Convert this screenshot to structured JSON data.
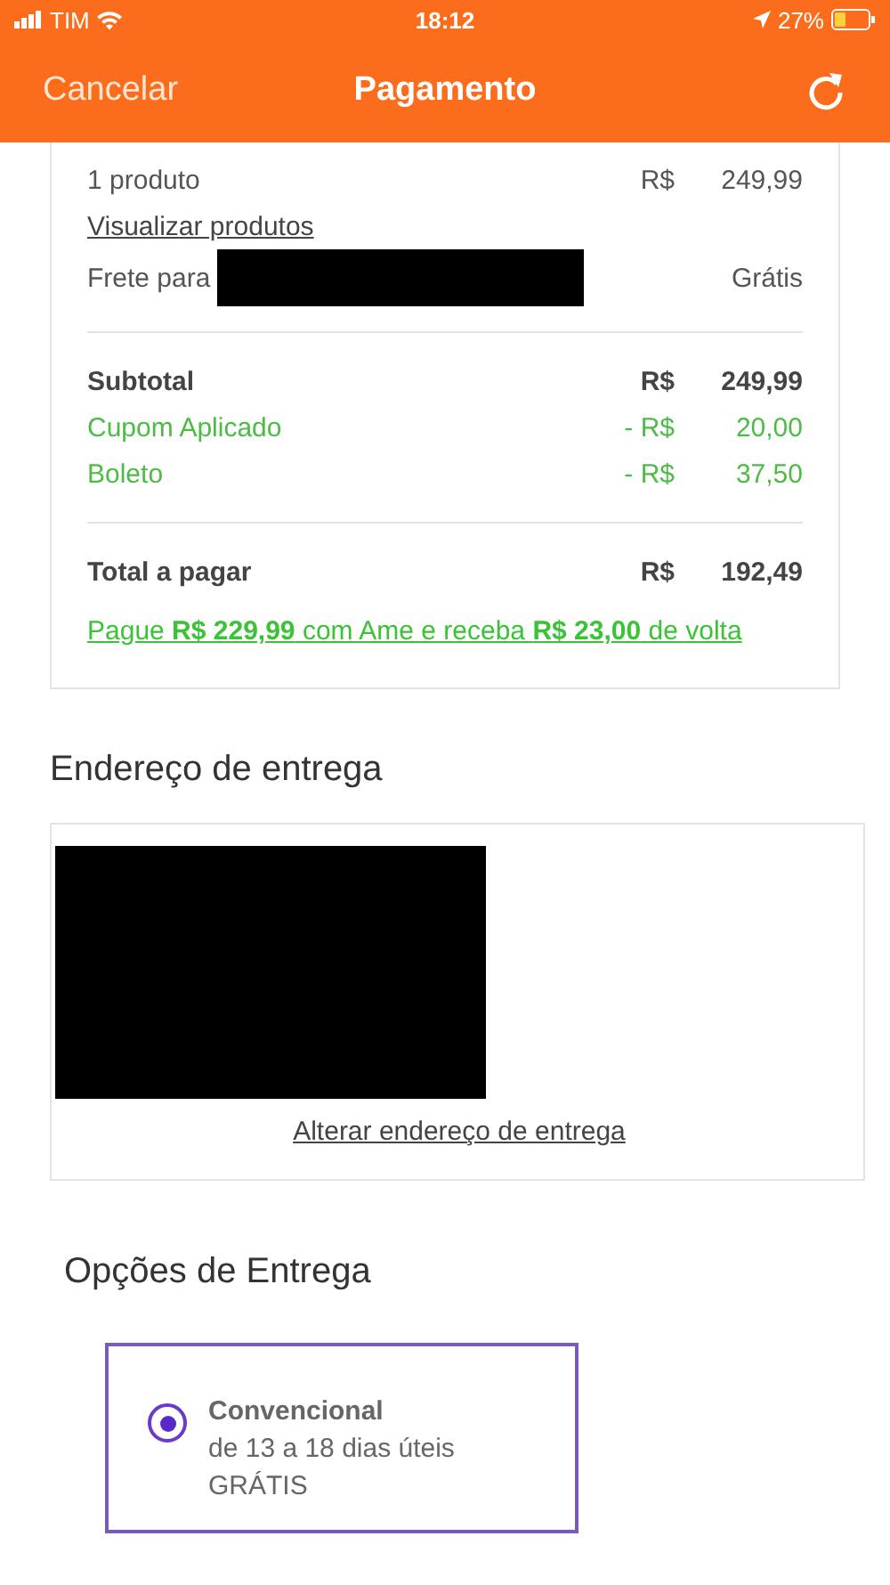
{
  "status_bar": {
    "carrier": "TIM",
    "time": "18:12",
    "battery": "27%"
  },
  "nav": {
    "cancel": "Cancelar",
    "title": "Pagamento"
  },
  "summary": {
    "product_count": "1 produto",
    "product_price": {
      "currency": "R$",
      "amount": "249,99"
    },
    "view_link": "Visualizar produtos",
    "shipping_label": "Frete para",
    "shipping_value": "Grátis",
    "lines": [
      {
        "label": "Subtotal",
        "currency": "R$",
        "amount": "249,99",
        "kind": "bold"
      },
      {
        "label": "Cupom Aplicado",
        "currency": "- R$",
        "amount": "20,00",
        "kind": "discount"
      },
      {
        "label": "Boleto",
        "currency": "- R$",
        "amount": "37,50",
        "kind": "discount"
      }
    ],
    "total": {
      "label": "Total a pagar",
      "currency": "R$",
      "amount": "192,49"
    },
    "promo_link": "Pague **R$ 229,99** com Ame e receba **R$ 23,00** de volta"
  },
  "address": {
    "heading": "Endereço de entrega",
    "change_link": "Alterar endereço de entrega"
  },
  "delivery": {
    "heading": "Opções de Entrega",
    "options": [
      {
        "name": "Convencional",
        "time": "de 13 a 18 dias úteis",
        "price": "GRÁTIS",
        "selected": true
      }
    ]
  }
}
